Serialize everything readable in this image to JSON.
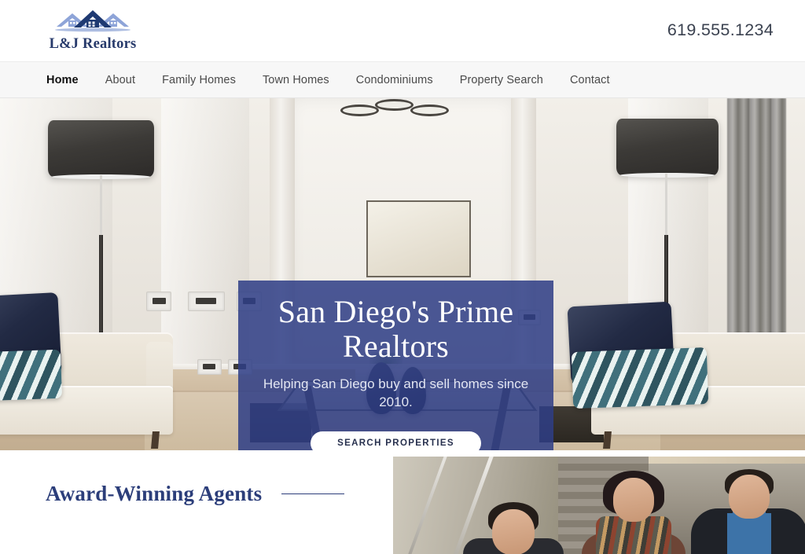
{
  "header": {
    "logo": {
      "text": "L&J Realtors",
      "icon": "house-roofs-icon",
      "color_dark": "#273a6b",
      "color_light": "#8ea4d8"
    },
    "phone": "619.555.1234"
  },
  "nav": {
    "items": [
      {
        "label": "Home",
        "active": true
      },
      {
        "label": "About",
        "active": false
      },
      {
        "label": "Family Homes",
        "active": false
      },
      {
        "label": "Town Homes",
        "active": false
      },
      {
        "label": "Condominiums",
        "active": false
      },
      {
        "label": "Property Search",
        "active": false
      },
      {
        "label": "Contact",
        "active": false
      }
    ]
  },
  "hero": {
    "background_image": "living-room-photo",
    "overlay_color": "#2e3e86",
    "title": "San Diego's Prime Realtors",
    "subtitle": "Helping San Diego buy and sell homes since 2010.",
    "button_label": "SEARCH PROPERTIES"
  },
  "agents_section": {
    "title": "Award-Winning Agents",
    "rule": true,
    "accent_color": "#2c3e7a",
    "photo": "three-agents-team-photo"
  }
}
